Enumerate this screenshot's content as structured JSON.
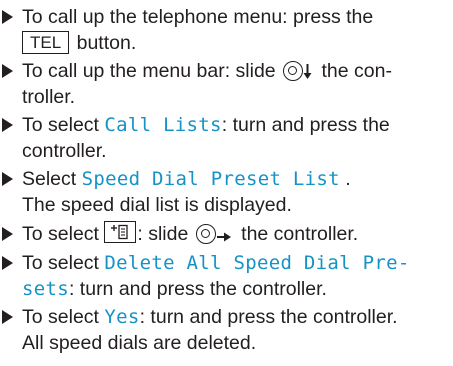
{
  "steps": [
    {
      "line1_pre": "To call up the telephone menu: press the",
      "key": "TEL",
      "line2_post": " button."
    },
    {
      "line1_pre": "To call up the menu bar: slide ",
      "line1_post": " the con-",
      "line2": "troller."
    },
    {
      "line1_pre": "To select ",
      "highlight": "Call Lists",
      "line1_post": ": turn and press the",
      "line2": "controller."
    },
    {
      "line1_pre": "Select ",
      "highlight": "Speed Dial Preset List",
      "line1_post": " .",
      "line2": "The speed dial list is displayed."
    },
    {
      "line1_pre": "To select ",
      "line1_mid": ": slide ",
      "line1_post": " the controller."
    },
    {
      "line1_pre": "To select ",
      "highlight1": "Delete All Speed Dial Pre-",
      "highlight2": "sets",
      "line2_post": ": turn and press the controller."
    },
    {
      "line1_pre": "To select ",
      "highlight": "Yes",
      "line1_post": ": turn and press the controller.",
      "line2": "All speed dials are deleted."
    }
  ],
  "icons": {
    "arrow": "bullet-triangle-icon",
    "controller": "controller-knob-icon",
    "slide_down": "arrow-down-icon",
    "slide_right": "arrow-right-icon",
    "options": "options-menu-icon"
  }
}
